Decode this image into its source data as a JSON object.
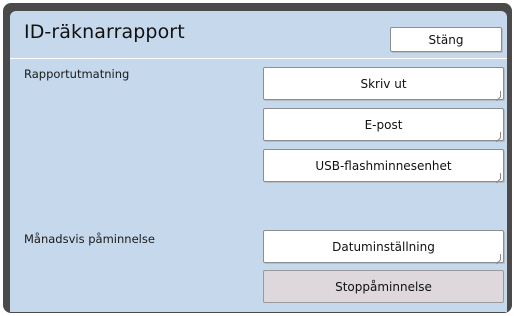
{
  "header": {
    "title": "ID-räknarrapport",
    "close_label": "Stäng"
  },
  "report_output": {
    "label": "Rapportutmatning",
    "buttons": [
      {
        "label": "Skriv ut"
      },
      {
        "label": "E-post"
      },
      {
        "label": "USB-flashminnesenhet"
      }
    ]
  },
  "monthly_reminder": {
    "label": "Månadsvis påminnelse",
    "buttons": [
      {
        "label": "Datuminställning"
      },
      {
        "label": "Stoppåminnelse",
        "disabled": true
      }
    ]
  },
  "colors": {
    "panel_background": "#c6d8ec",
    "frame": "#4a4a4a",
    "button_background": "#ffffff",
    "disabled_button_background": "#ded7dc"
  }
}
